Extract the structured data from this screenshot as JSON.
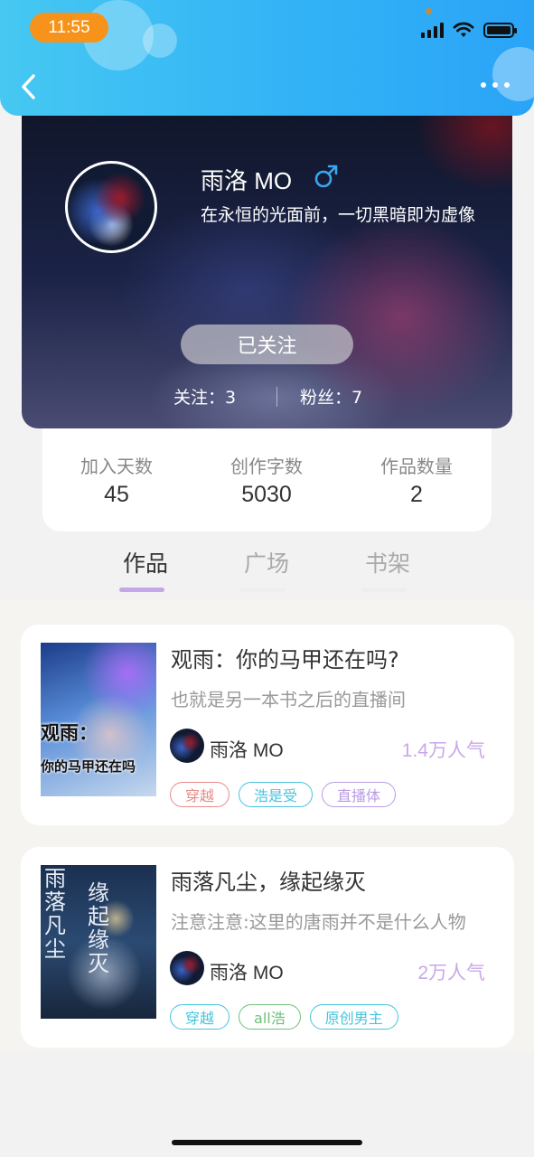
{
  "status_bar": {
    "time": "11:55"
  },
  "profile": {
    "name": "雨洛 MO",
    "gender_icon": "male-symbol",
    "signature": "在永恒的光面前，一切黑暗即为虚像",
    "follow_button": "已关注",
    "following_text": "关注：3",
    "fans_text": "粉丝：7"
  },
  "stats": [
    {
      "label": "加入天数",
      "value": "45"
    },
    {
      "label": "创作字数",
      "value": "5030"
    },
    {
      "label": "作品数量",
      "value": "2"
    }
  ],
  "tabs": [
    "作品",
    "广场",
    "书架"
  ],
  "books": [
    {
      "title": "观雨：你的马甲还在吗?",
      "description": "也就是另一本书之后的直播间",
      "cover_text_line1": "观雨：",
      "cover_text_line2": "你的马甲还在吗",
      "author": "雨洛 MO",
      "popularity": "1.4万人气",
      "tags": [
        {
          "label": "穿越",
          "color": "#e98a86"
        },
        {
          "label": "浩是受",
          "color": "#45c4de"
        },
        {
          "label": "直播体",
          "color": "#b99be4"
        }
      ]
    },
    {
      "title": "雨落凡尘，缘起缘灭",
      "description": "注意注意:这里的唐雨并不是什么人物",
      "cover_text_col1": "雨落凡尘",
      "cover_text_col2": "缘起缘灭",
      "author": "雨洛 MO",
      "popularity": "2万人气",
      "tags": [
        {
          "label": "穿越",
          "color": "#45c4de"
        },
        {
          "label": "all浩",
          "color": "#6fc07a"
        },
        {
          "label": "原创男主",
          "color": "#45c4de"
        }
      ]
    }
  ]
}
